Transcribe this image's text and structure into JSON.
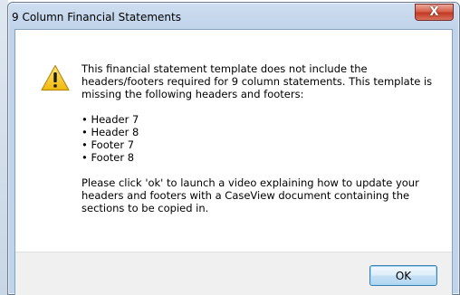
{
  "window": {
    "title": "9 Column Financial Statements",
    "close_symbol": "X"
  },
  "message": {
    "intro": "This financial statement template does not include the headers/footers required for 9 column statements. This template is missing the following headers and footers:",
    "items": [
      "Header 7",
      "Header 8",
      "Footer 7",
      "Footer 8"
    ],
    "outro": "Please click 'ok' to launch a video explaining how to update your headers and footers with a CaseView document containing the sections to be copied in."
  },
  "buttons": {
    "ok_label": "OK"
  },
  "icons": {
    "warning": "warning-icon",
    "close": "close-icon"
  },
  "colors": {
    "warning_fill": "#f5c518",
    "close_button": "#c7432b",
    "ok_border": "#3c7fb1"
  }
}
